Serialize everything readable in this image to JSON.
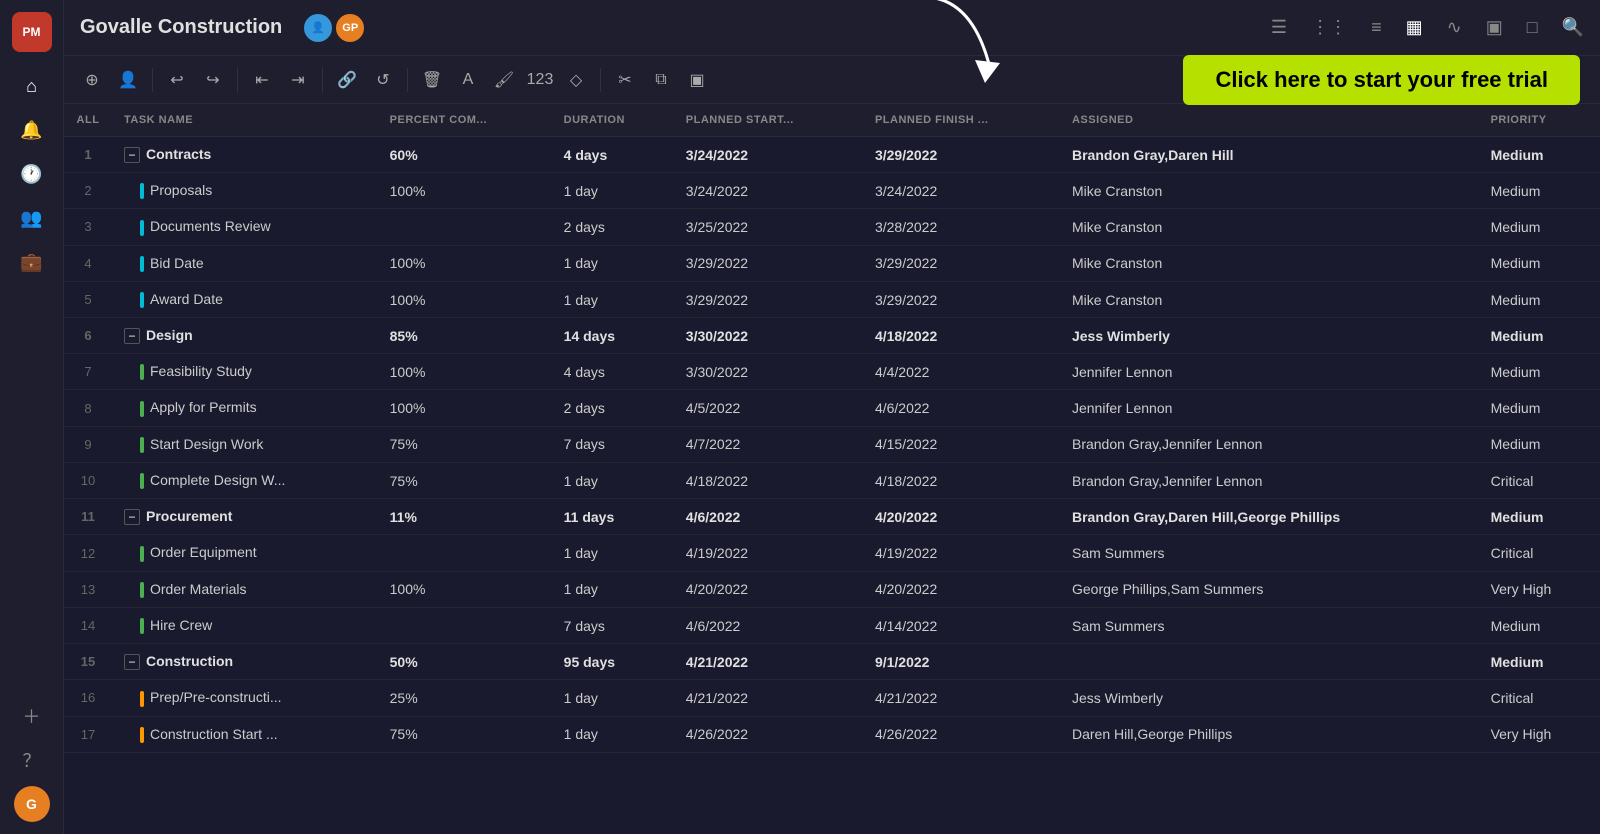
{
  "app": {
    "logo": "PM",
    "project_title": "Govalle Construction"
  },
  "nav": {
    "view_icons": [
      "≡",
      "⡉",
      "≡",
      "▦",
      "∿",
      "▣",
      "□"
    ],
    "search_label": "🔍"
  },
  "toolbar": {
    "buttons": [
      "+",
      "👤",
      "|",
      "⇐",
      "⇒",
      "|",
      "🔗",
      "↺",
      "|",
      "🗑",
      "A",
      "◇",
      "123",
      "◇",
      "|",
      "✂",
      "⧉",
      "▣"
    ],
    "free_trial_label": "Click here to start your free trial"
  },
  "table": {
    "columns": [
      "ALL",
      "TASK NAME",
      "PERCENT COM...",
      "DURATION",
      "PLANNED START...",
      "PLANNED FINISH ...",
      "ASSIGNED",
      "PRIORITY"
    ],
    "rows": [
      {
        "id": 1,
        "task": "Contracts",
        "percent": "60%",
        "duration": "4 days",
        "start": "3/24/2022",
        "finish": "3/29/2022",
        "assigned": "Brandon Gray,Daren Hill",
        "priority": "Medium",
        "group": true,
        "bar": "cyan"
      },
      {
        "id": 2,
        "task": "Proposals",
        "percent": "100%",
        "duration": "1 day",
        "start": "3/24/2022",
        "finish": "3/24/2022",
        "assigned": "Mike Cranston",
        "priority": "Medium",
        "indent": true,
        "bar": "cyan"
      },
      {
        "id": 3,
        "task": "Documents Review",
        "percent": "",
        "duration": "2 days",
        "start": "3/25/2022",
        "finish": "3/28/2022",
        "assigned": "Mike Cranston",
        "priority": "Medium",
        "indent": true,
        "bar": "cyan"
      },
      {
        "id": 4,
        "task": "Bid Date",
        "percent": "100%",
        "duration": "1 day",
        "start": "3/29/2022",
        "finish": "3/29/2022",
        "assigned": "Mike Cranston",
        "priority": "Medium",
        "indent": true,
        "bar": "cyan"
      },
      {
        "id": 5,
        "task": "Award Date",
        "percent": "100%",
        "duration": "1 day",
        "start": "3/29/2022",
        "finish": "3/29/2022",
        "assigned": "Mike Cranston",
        "priority": "Medium",
        "indent": true,
        "bar": "cyan"
      },
      {
        "id": 6,
        "task": "Design",
        "percent": "85%",
        "duration": "14 days",
        "start": "3/30/2022",
        "finish": "4/18/2022",
        "assigned": "Jess Wimberly",
        "priority": "Medium",
        "group": true,
        "bar": "green"
      },
      {
        "id": 7,
        "task": "Feasibility Study",
        "percent": "100%",
        "duration": "4 days",
        "start": "3/30/2022",
        "finish": "4/4/2022",
        "assigned": "Jennifer Lennon",
        "priority": "Medium",
        "indent": true,
        "bar": "green"
      },
      {
        "id": 8,
        "task": "Apply for Permits",
        "percent": "100%",
        "duration": "2 days",
        "start": "4/5/2022",
        "finish": "4/6/2022",
        "assigned": "Jennifer Lennon",
        "priority": "Medium",
        "indent": true,
        "bar": "green"
      },
      {
        "id": 9,
        "task": "Start Design Work",
        "percent": "75%",
        "duration": "7 days",
        "start": "4/7/2022",
        "finish": "4/15/2022",
        "assigned": "Brandon Gray,Jennifer Lennon",
        "priority": "Medium",
        "indent": true,
        "bar": "green"
      },
      {
        "id": 10,
        "task": "Complete Design W...",
        "percent": "75%",
        "duration": "1 day",
        "start": "4/18/2022",
        "finish": "4/18/2022",
        "assigned": "Brandon Gray,Jennifer Lennon",
        "priority": "Critical",
        "indent": true,
        "bar": "green"
      },
      {
        "id": 11,
        "task": "Procurement",
        "percent": "11%",
        "duration": "11 days",
        "start": "4/6/2022",
        "finish": "4/20/2022",
        "assigned": "Brandon Gray,Daren Hill,George Phillips",
        "priority": "Medium",
        "group": true,
        "bar": "green"
      },
      {
        "id": 12,
        "task": "Order Equipment",
        "percent": "",
        "duration": "1 day",
        "start": "4/19/2022",
        "finish": "4/19/2022",
        "assigned": "Sam Summers",
        "priority": "Critical",
        "indent": true,
        "bar": "green"
      },
      {
        "id": 13,
        "task": "Order Materials",
        "percent": "100%",
        "duration": "1 day",
        "start": "4/20/2022",
        "finish": "4/20/2022",
        "assigned": "George Phillips,Sam Summers",
        "priority": "Very High",
        "indent": true,
        "bar": "green"
      },
      {
        "id": 14,
        "task": "Hire Crew",
        "percent": "",
        "duration": "7 days",
        "start": "4/6/2022",
        "finish": "4/14/2022",
        "assigned": "Sam Summers",
        "priority": "Medium",
        "indent": true,
        "bar": "green"
      },
      {
        "id": 15,
        "task": "Construction",
        "percent": "50%",
        "duration": "95 days",
        "start": "4/21/2022",
        "finish": "9/1/2022",
        "assigned": "",
        "priority": "Medium",
        "group": true,
        "bar": "orange"
      },
      {
        "id": 16,
        "task": "Prep/Pre-constructi...",
        "percent": "25%",
        "duration": "1 day",
        "start": "4/21/2022",
        "finish": "4/21/2022",
        "assigned": "Jess Wimberly",
        "priority": "Critical",
        "indent": true,
        "bar": "orange"
      },
      {
        "id": 17,
        "task": "Construction Start ...",
        "percent": "75%",
        "duration": "1 day",
        "start": "4/26/2022",
        "finish": "4/26/2022",
        "assigned": "Daren Hill,George Phillips",
        "priority": "Very High",
        "indent": true,
        "bar": "orange"
      }
    ]
  },
  "sidebar": {
    "icons": [
      "🏠",
      "🔔",
      "🕐",
      "👥",
      "💼",
      "+",
      "?"
    ],
    "avatar_initials": "G"
  }
}
